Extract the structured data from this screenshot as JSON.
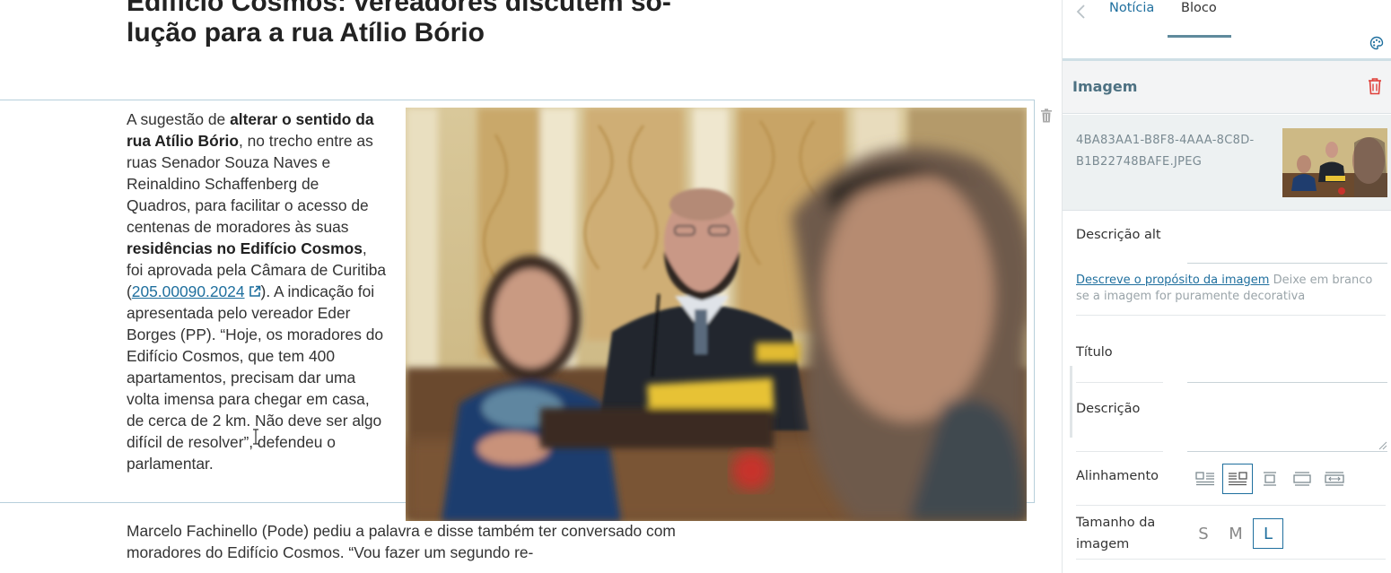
{
  "editor": {
    "headline_line1": "Edifício Cosmos: vereadores discutem so-",
    "headline_line2": "lução para a rua Atílio Bório",
    "paragraph1": {
      "t1": "A sugestão de ",
      "b1": "alterar o sentido da rua Atílio Bório",
      "t2": ", no trecho entre as ruas Senador Souza Naves e Reinaldino Schaffenberg de Quadros, para facilitar o acesso de centenas de moradores às suas ",
      "b2": "residências no Edifício Cosmos",
      "t3": ", foi aprovada pela Câmara de Curitiba (",
      "link": "205.00090.2024",
      "t4": "). A indicação foi apresentada pelo vereador Eder Borges (PP). “Hoje, os moradores do Edifício Cosmos, que tem 400 apartamentos, precisam dar uma volta imensa para chegar em casa, de cerca de 2 km. Não deve ser algo difícil de resolver”, defendeu o parlamentar."
    },
    "paragraph2": "Marcelo Fachinello (Pode) pediu a palavra e disse também ter conversado com moradores do Edifício Cosmos. “Vou fazer um segundo re-"
  },
  "sidebar": {
    "tabs": {
      "noticia": "Notícia",
      "bloco": "Bloco"
    },
    "section_title": "Imagem",
    "image_filename": "4BA83AA1-B8F8-4AAA-8C8D-B1B22748BAFE.JPEG",
    "fields": {
      "alt_label": "Descrição alt",
      "alt_help_link": "Descreve o propósito da imagem",
      "alt_help_text": " Deixe em branco se a imagem for puramente decorativa",
      "title_label": "Título",
      "description_label": "Descrição",
      "alignment_label": "Alinhamento",
      "size_label": "Tamanho da imagem"
    },
    "sizes": [
      "S",
      "M",
      "L"
    ],
    "selected_size": "L",
    "selected_alignment": "left-wrap"
  },
  "colors": {
    "accent": "#1f6f9e",
    "danger": "#e0403a",
    "section_title": "#4d7182"
  }
}
